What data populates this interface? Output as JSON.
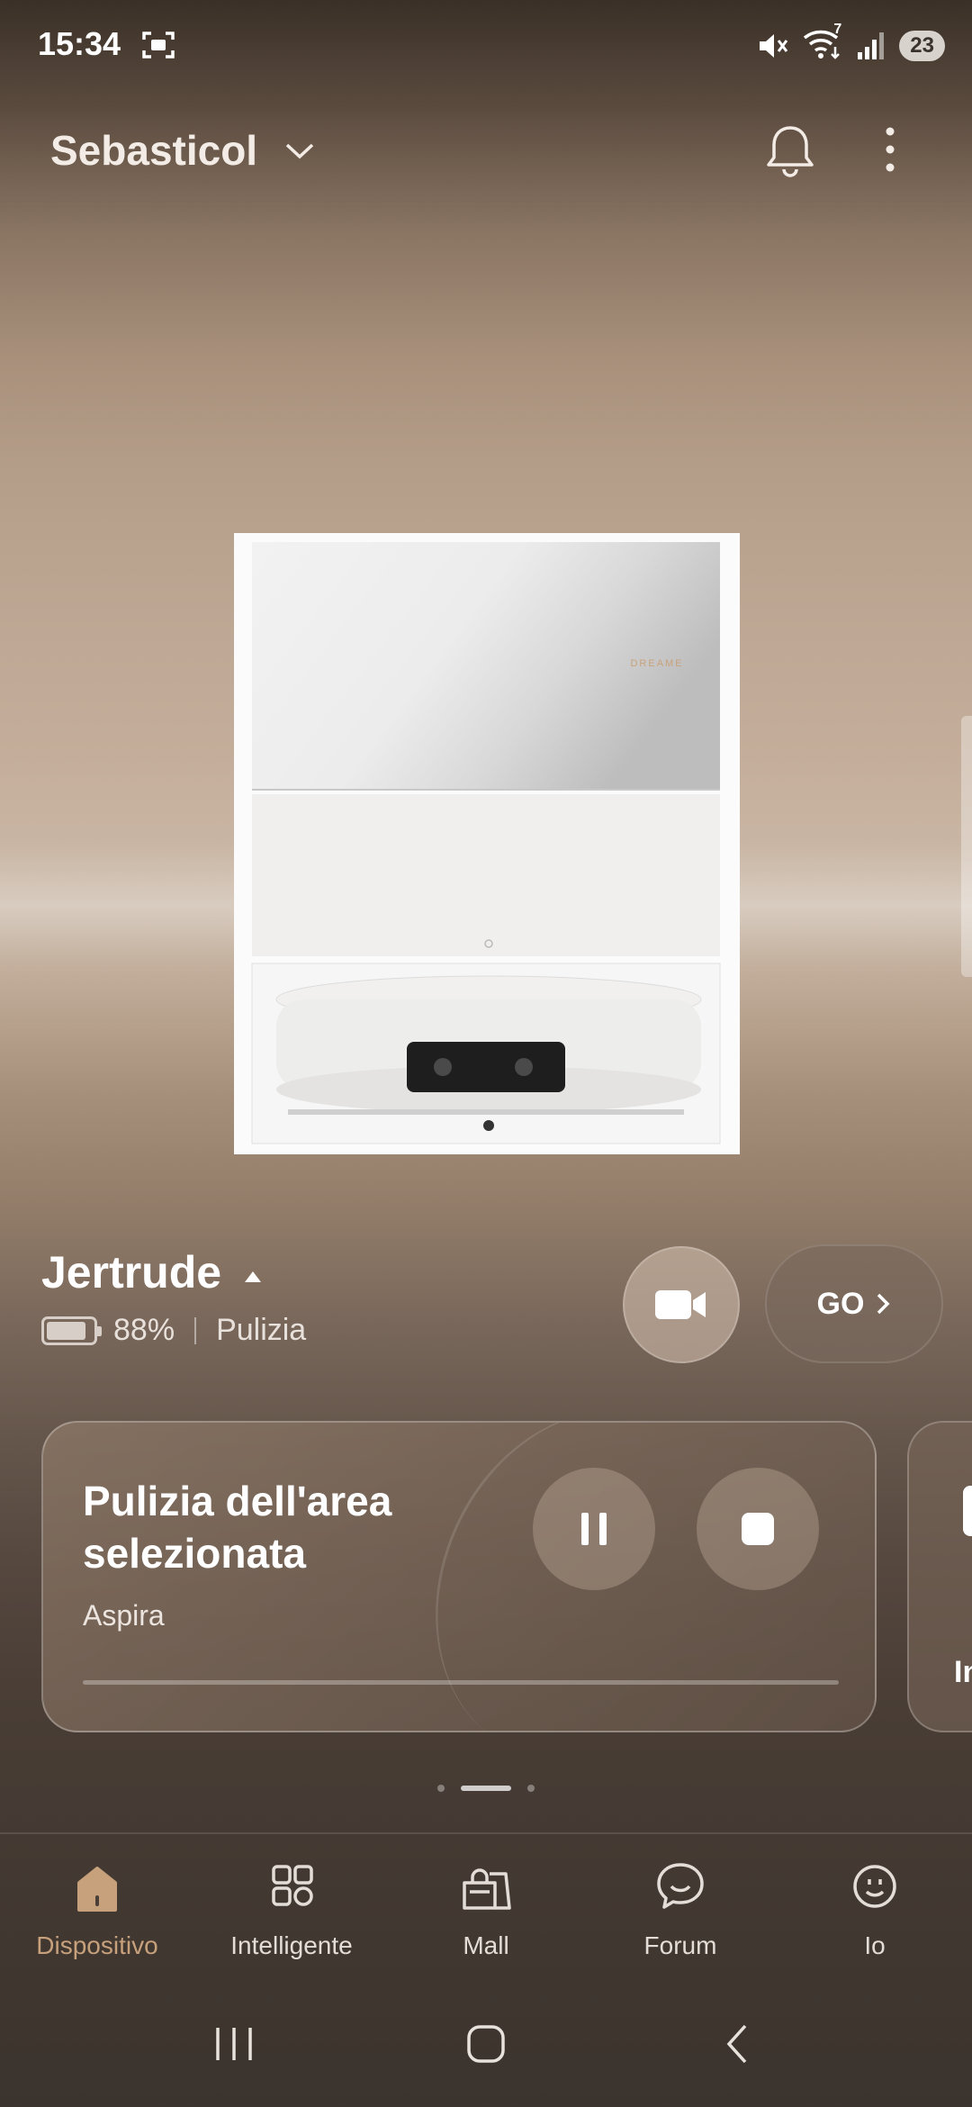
{
  "status_bar": {
    "time": "15:34",
    "wifi_badge": "7",
    "battery": "23"
  },
  "header": {
    "home_name": "Sebasticol"
  },
  "device": {
    "brand": "DREAME",
    "name": "Jertrude",
    "battery_percent": "88%",
    "battery_level": 0.88,
    "mode": "Pulizia",
    "go_label": "GO"
  },
  "task_card": {
    "title": "Pulizia dell'area selezionata",
    "subtitle": "Aspira",
    "progress": 0
  },
  "next_card": {
    "label_partial": "In"
  },
  "pagination": {
    "count": 3,
    "active_index": 1
  },
  "tabs": [
    {
      "label": "Dispositivo",
      "icon": "home-icon",
      "active": true
    },
    {
      "label": "Intelligente",
      "icon": "grid-icon",
      "active": false
    },
    {
      "label": "Mall",
      "icon": "shopping-bag-icon",
      "active": false
    },
    {
      "label": "Forum",
      "icon": "forum-bubble-icon",
      "active": false
    },
    {
      "label": "Io",
      "icon": "profile-smile-icon",
      "active": false
    }
  ],
  "colors": {
    "accent": "#c7a07c",
    "text": "#ffffff"
  }
}
